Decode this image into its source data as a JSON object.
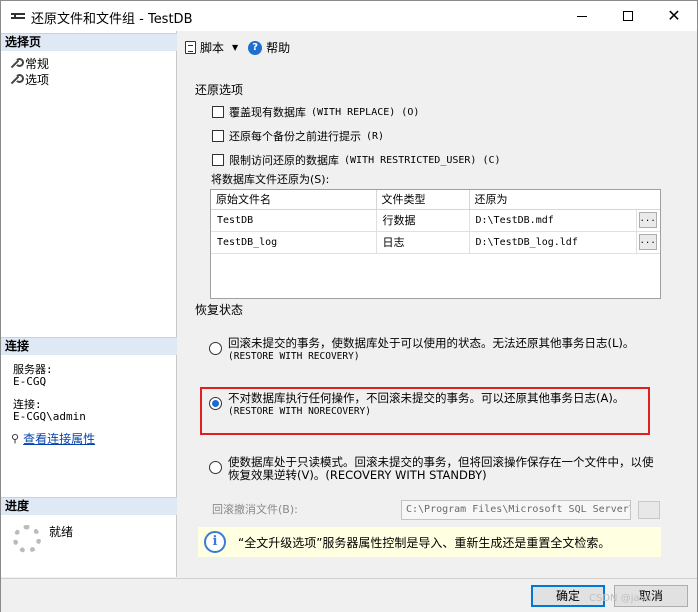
{
  "window": {
    "title": "还原文件和文件组 - TestDB"
  },
  "left": {
    "select_page_header": "选择页",
    "nav_items": [
      {
        "label": "常规"
      },
      {
        "label": "选项"
      }
    ],
    "connection_header": "连接",
    "server_label": "服务器:",
    "server_value": "E-CGQ",
    "connection_label": "连接:",
    "connection_value": "E-CGQ\\admin",
    "view_connection_link": "查看连接属性",
    "progress_header": "进度",
    "progress_status": "就绪"
  },
  "toolbar": {
    "script_label": "脚本",
    "help_label": "帮助"
  },
  "restore_options": {
    "group_label": "还原选项",
    "checkboxes": [
      {
        "label_cjk": "覆盖现有数据库",
        "label_code": "(WITH REPLACE) (O)",
        "checked": false
      },
      {
        "label_cjk": "还原每个备份之前进行提示",
        "label_code": "(R)",
        "checked": false
      },
      {
        "label_cjk": "限制访问还原的数据库",
        "label_code": "(WITH RESTRICTED_USER) (C)",
        "checked": false
      }
    ],
    "restore_files_as_label": "将数据库文件还原为(S):",
    "columns": [
      "原始文件名",
      "文件类型",
      "还原为"
    ],
    "rows": [
      {
        "original": "TestDB",
        "type": "行数据",
        "restore_as": "D:\\TestDB.mdf",
        "button": "..."
      },
      {
        "original": "TestDB_log",
        "type": "日志",
        "restore_as": "D:\\TestDB_log.ldf",
        "button": "..."
      }
    ]
  },
  "recovery": {
    "group_label": "恢复状态",
    "options": [
      {
        "text": "回滚未提交的事务，使数据库处于可以使用的状态。无法还原其他事务日志(L)。",
        "code": "(RESTORE WITH RECOVERY)",
        "checked": false
      },
      {
        "text": "不对数据库执行任何操作，不回滚未提交的事务。可以还原其他事务日志(A)。",
        "code": "(RESTORE WITH NORECOVERY)",
        "checked": true
      },
      {
        "text": "使数据库处于只读模式。回滚未提交的事务，但将回滚操作保存在一个文件中，以使",
        "text2": "恢复效果逆转(V)。(RECOVERY WITH STANDBY)",
        "checked": false
      }
    ],
    "undo_file_label": "回滚撤消文件(B):",
    "undo_file_value": "C:\\Program Files\\Microsoft SQL Server\\MS"
  },
  "info": {
    "text": "“全文升级选项”服务器属性控制是导入、重新生成还是重置全文检索。"
  },
  "buttons": {
    "ok": "确定",
    "cancel": "取消"
  },
  "watermark": "CSDN @java"
}
